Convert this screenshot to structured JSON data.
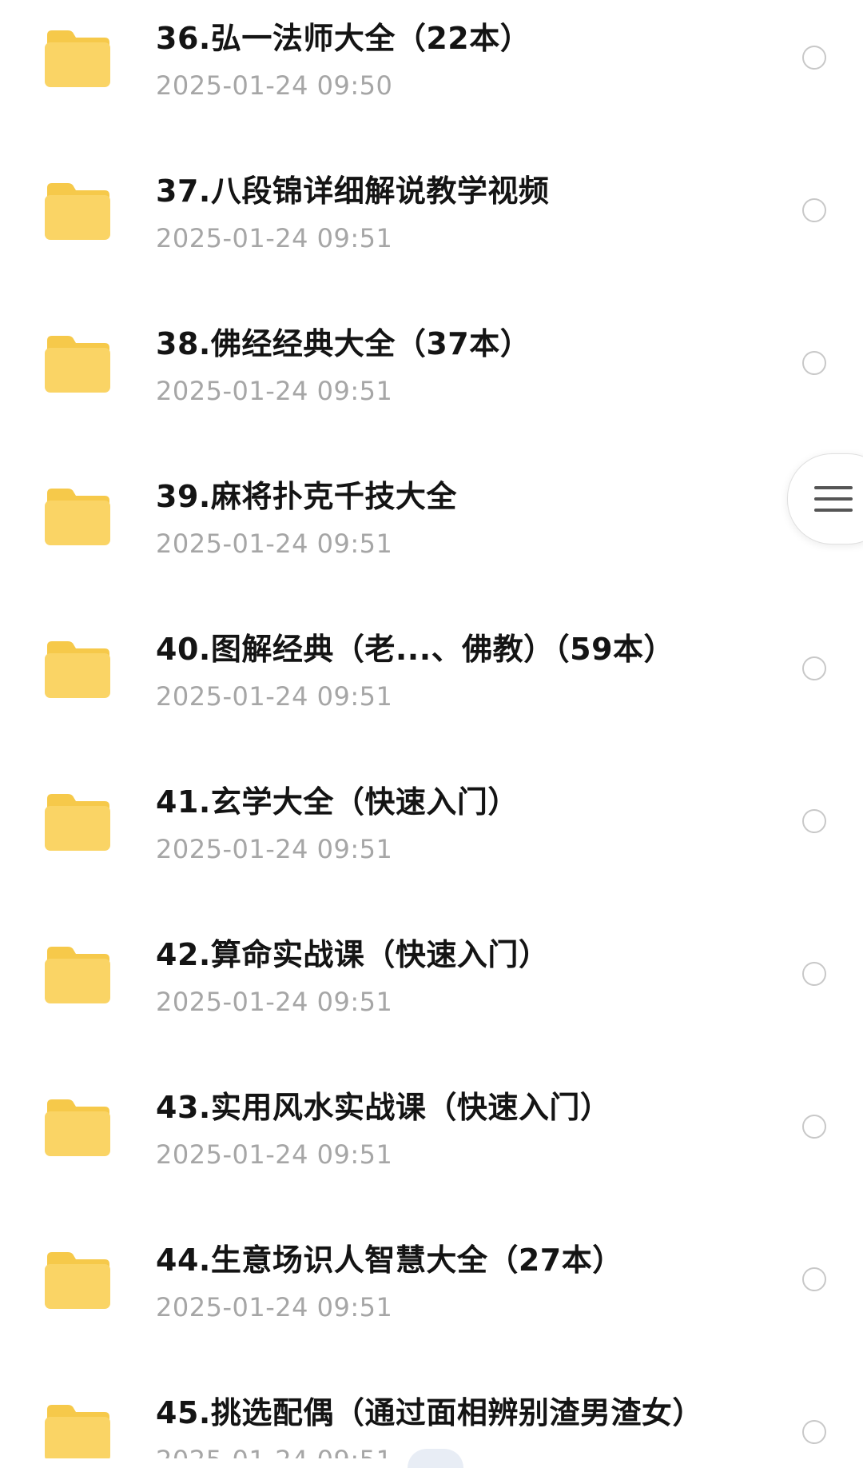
{
  "colors": {
    "folder_body": "#FAD465",
    "folder_tab": "#F6C94A",
    "name_text": "#141414",
    "time_text": "#A6A6A6",
    "checkbox_border": "#C8C8C8"
  },
  "files": [
    {
      "name": "36.弘一法师大全（22本）",
      "time": "2025-01-24 09:50",
      "icon": "folder-icon"
    },
    {
      "name": "37.八段锦详细解说教学视频",
      "time": "2025-01-24 09:51",
      "icon": "folder-icon"
    },
    {
      "name": "38.佛经经典大全（37本）",
      "time": "2025-01-24 09:51",
      "icon": "folder-icon"
    },
    {
      "name": "39.麻将扑克千技大全",
      "time": "2025-01-24 09:51",
      "icon": "folder-icon"
    },
    {
      "name": "40.图解经典（老...、佛教）（59本）",
      "time": "2025-01-24 09:51",
      "icon": "folder-icon"
    },
    {
      "name": "41.玄学大全（快速入门）",
      "time": "2025-01-24 09:51",
      "icon": "folder-icon"
    },
    {
      "name": "42.算命实战课（快速入门）",
      "time": "2025-01-24 09:51",
      "icon": "folder-icon"
    },
    {
      "name": "43.实用风水实战课（快速入门）",
      "time": "2025-01-24 09:51",
      "icon": "folder-icon"
    },
    {
      "name": "44.生意场识人智慧大全（27本）",
      "time": "2025-01-24 09:51",
      "icon": "folder-icon"
    },
    {
      "name": "45.挑选配偶（通过面相辨别渣男渣女）",
      "time": "2025-01-24 09:51",
      "icon": "folder-icon"
    }
  ],
  "menu_button": {
    "icon": "menu-icon"
  }
}
